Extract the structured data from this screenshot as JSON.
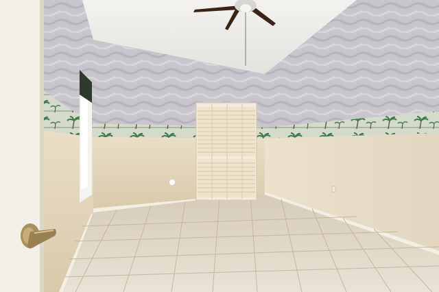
{
  "scene": {
    "type": "photo",
    "subject": "empty-bedroom-interior",
    "elements": [
      "ceiling-fan",
      "bifold-closet-door",
      "window",
      "wallpaper-border-palm-trees",
      "ceramic-tile-floor",
      "door-lever-handle",
      "wall-outlet"
    ]
  },
  "colors": {
    "ceiling": "#eceae6",
    "upper_wall": "#c9c6cc",
    "lower_wall": "#e8dcc4",
    "border_band": "#cfd8c8",
    "palm_green": "#3f7a4a",
    "floor_tile": "#dcd2c2",
    "grout": "#cbbfa9",
    "closet_door": "#f0e6d4",
    "fan_blade": "#3a2418",
    "handle_brass": "#a89060",
    "door_panel": "#f2efe6"
  }
}
